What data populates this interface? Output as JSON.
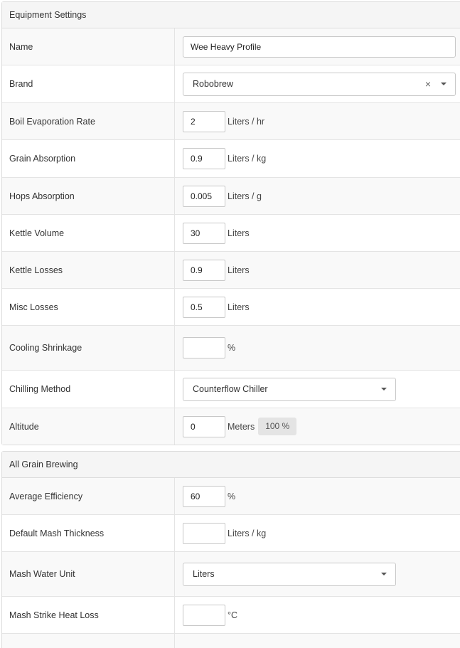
{
  "equipment": {
    "header": "Equipment Settings",
    "name": {
      "label": "Name",
      "value": "Wee Heavy Profile"
    },
    "brand": {
      "label": "Brand",
      "value": "Robobrew",
      "clear_glyph": "×"
    },
    "boil_evaporation": {
      "label": "Boil Evaporation Rate",
      "value": "2",
      "unit": "Liters / hr"
    },
    "grain_absorption": {
      "label": "Grain Absorption",
      "value": "0.9",
      "unit": "Liters / kg"
    },
    "hops_absorption": {
      "label": "Hops Absorption",
      "value": "0.005",
      "unit": "Liters / g"
    },
    "kettle_volume": {
      "label": "Kettle Volume",
      "value": "30",
      "unit": "Liters"
    },
    "kettle_losses": {
      "label": "Kettle Losses",
      "value": "0.9",
      "unit": "Liters"
    },
    "misc_losses": {
      "label": "Misc Losses",
      "value": "0.5",
      "unit": "Liters"
    },
    "cooling_shrinkage": {
      "label": "Cooling Shrinkage",
      "value": "",
      "unit": "%"
    },
    "chilling_method": {
      "label": "Chilling Method",
      "value": "Counterflow Chiller"
    },
    "altitude": {
      "label": "Altitude",
      "value": "0",
      "unit": "Meters",
      "badge": "100 %"
    }
  },
  "all_grain": {
    "header": "All Grain Brewing",
    "average_efficiency": {
      "label": "Average Efficiency",
      "value": "60",
      "unit": "%"
    },
    "mash_thickness": {
      "label": "Default Mash Thickness",
      "value": "",
      "unit": "Liters / kg"
    },
    "mash_water_unit": {
      "label": "Mash Water Unit",
      "value": "Liters"
    },
    "mash_strike_heat_loss": {
      "label": "Mash Strike Heat Loss",
      "value": "",
      "unit": "°C"
    }
  },
  "icons": {
    "dropdown": "chevron-down-icon",
    "clear": "close-icon"
  }
}
